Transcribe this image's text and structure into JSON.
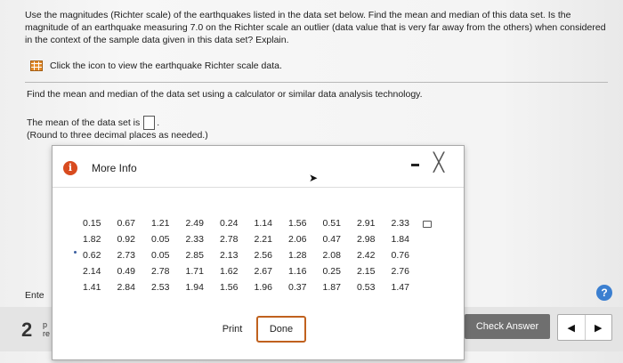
{
  "question": {
    "text": "Use the magnitudes (Richter scale) of the earthquakes listed in the data set below. Find the mean and median of this data set. Is the magnitude of an earthquake measuring 7.0 on the Richter scale an outlier (data value that is very far away from the others) when considered in the context of the sample data given in this data set? Explain."
  },
  "data_link": {
    "label": "Click the icon to view the earthquake Richter scale data.",
    "icon": "table-icon"
  },
  "instruction": "Find the mean and median of the data set using a calculator or similar data analysis technology.",
  "mean_prompt": "The mean of the data set is",
  "mean_suffix": ".",
  "round_note": "(Round to three decimal places as needed.)",
  "enter_label": "Ente",
  "footer": {
    "big_number": "2",
    "small_p": "p",
    "small_re": "re",
    "check_answer": "Check Answer",
    "prev": "◀",
    "next": "▶"
  },
  "help": "?",
  "modal": {
    "title": "More Info",
    "info_icon": "i",
    "minimize": "—",
    "close": "╳",
    "print_label": "Print",
    "done_label": "Done",
    "table": [
      [
        "0.15",
        "0.67",
        "1.21",
        "2.49",
        "0.24",
        "1.14",
        "1.56",
        "0.51",
        "2.91",
        "2.33"
      ],
      [
        "1.82",
        "0.92",
        "0.05",
        "2.33",
        "2.78",
        "2.21",
        "2.06",
        "0.47",
        "2.98",
        "1.84"
      ],
      [
        "0.62",
        "2.73",
        "0.05",
        "2.85",
        "2.13",
        "2.56",
        "1.28",
        "2.08",
        "2.42",
        "0.76"
      ],
      [
        "2.14",
        "0.49",
        "2.78",
        "1.71",
        "1.62",
        "2.67",
        "1.16",
        "0.25",
        "2.15",
        "2.76"
      ],
      [
        "1.41",
        "2.84",
        "2.53",
        "1.94",
        "1.56",
        "1.96",
        "0.37",
        "1.87",
        "0.53",
        "1.47"
      ]
    ]
  },
  "colors": {
    "accent": "#c0611e",
    "info": "#d84b1f",
    "help": "#3b7fd0",
    "check_answer_bg": "#6f6f6f"
  }
}
